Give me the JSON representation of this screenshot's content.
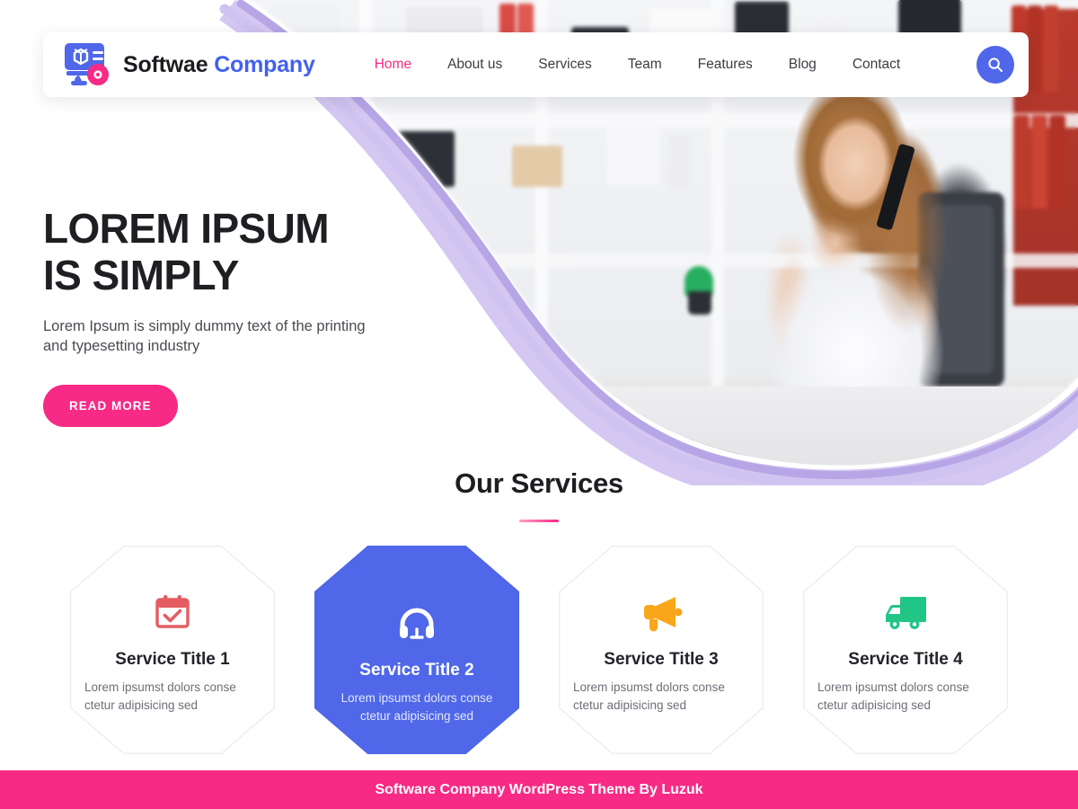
{
  "header": {
    "logo_icon": "monitor-cube-disc-logo-icon",
    "brand_name_primary": "Softwae",
    "brand_name_accent": "Company",
    "nav": [
      {
        "label": "Home",
        "active": true
      },
      {
        "label": "About us",
        "active": false
      },
      {
        "label": "Services",
        "active": false
      },
      {
        "label": "Team",
        "active": false
      },
      {
        "label": "Features",
        "active": false
      },
      {
        "label": "Blog",
        "active": false
      },
      {
        "label": "Contact",
        "active": false
      }
    ],
    "search_icon": "search-icon",
    "accent_color": "#f72a85",
    "brand_blue": "#4361ee"
  },
  "hero": {
    "title_line1": "LOREM IPSUM",
    "title_line2": "IS SIMPLY",
    "description": "Lorem Ipsum is simply dummy text of the printing and typesetting industry",
    "cta_label": "READ MORE",
    "cta_color": "#f72a85",
    "curve_color_light": "#cfc2f0",
    "curve_color_dark": "#b3a3e8",
    "image_alt": "woman-on-phone-in-office-photo"
  },
  "services": {
    "heading": "Our Services",
    "divider_color": "#f72a85",
    "cards": [
      {
        "title": "Service Title 1",
        "description": "Lorem ipsumst dolors conse ctetur adipisicing sed",
        "icon": "calendar-check-icon",
        "icon_color": "#e35d63",
        "featured": false
      },
      {
        "title": "Service Title 2",
        "description": "Lorem ipsumst dolors conse ctetur adipisicing sed",
        "icon": "headphones-icon",
        "icon_color": "#ffffff",
        "featured": true,
        "background_color": "#4f67e8"
      },
      {
        "title": "Service Title 3",
        "description": "Lorem ipsumst dolors conse ctetur adipisicing sed",
        "icon": "megaphone-icon",
        "icon_color": "#f9a61a",
        "featured": false
      },
      {
        "title": "Service Title 4",
        "description": "Lorem ipsumst dolors conse ctetur adipisicing sed",
        "icon": "delivery-truck-icon",
        "icon_color": "#21c586",
        "featured": false
      }
    ]
  },
  "footer": {
    "text": "Software Company WordPress Theme By Luzuk",
    "background_color": "#f72a85"
  }
}
